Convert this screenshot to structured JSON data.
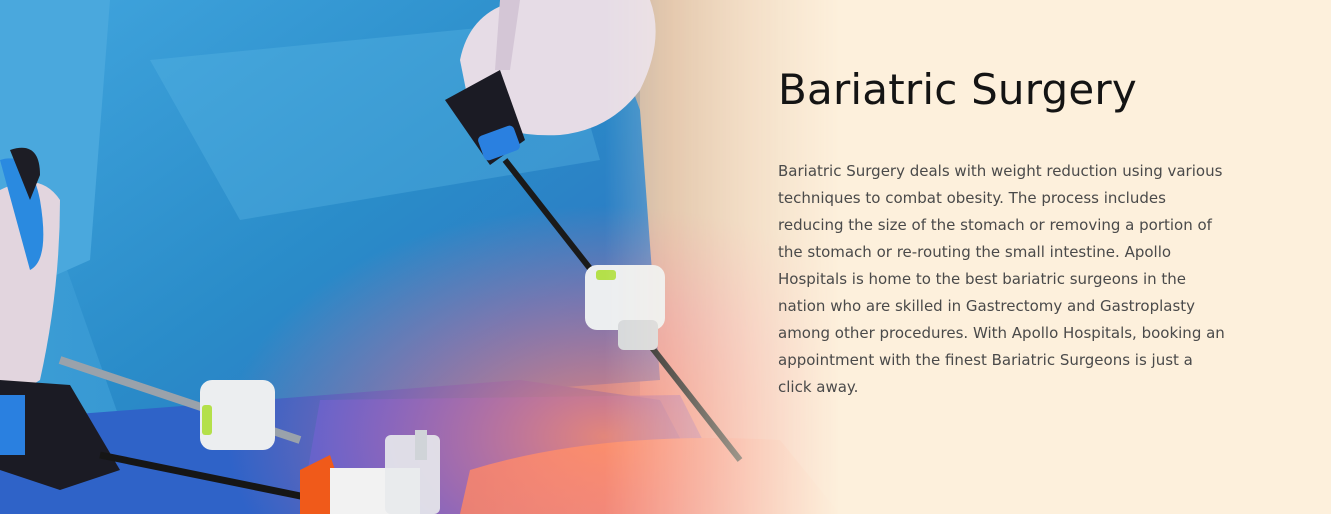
{
  "banner": {
    "title": "Bariatric Surgery",
    "description": "Bariatric Surgery deals with weight reduction using various techniques to combat obesity. The process includes reducing the size of the stomach or removing a portion of the stomach or re-routing the small intestine. Apollo Hospitals is home to the best bariatric surgeons in the nation who are skilled in Gastrectomy and Gastroplasty among other procedures. With Apollo Hospitals, booking an appointment with the finest Bariatric Surgeons is just a click away.",
    "colors": {
      "background": "#fdf0dc",
      "gown": "#2e8fd0",
      "instrument_accent": "#f05a1a"
    },
    "image_subject": "laparoscopic-surgery-photo"
  }
}
